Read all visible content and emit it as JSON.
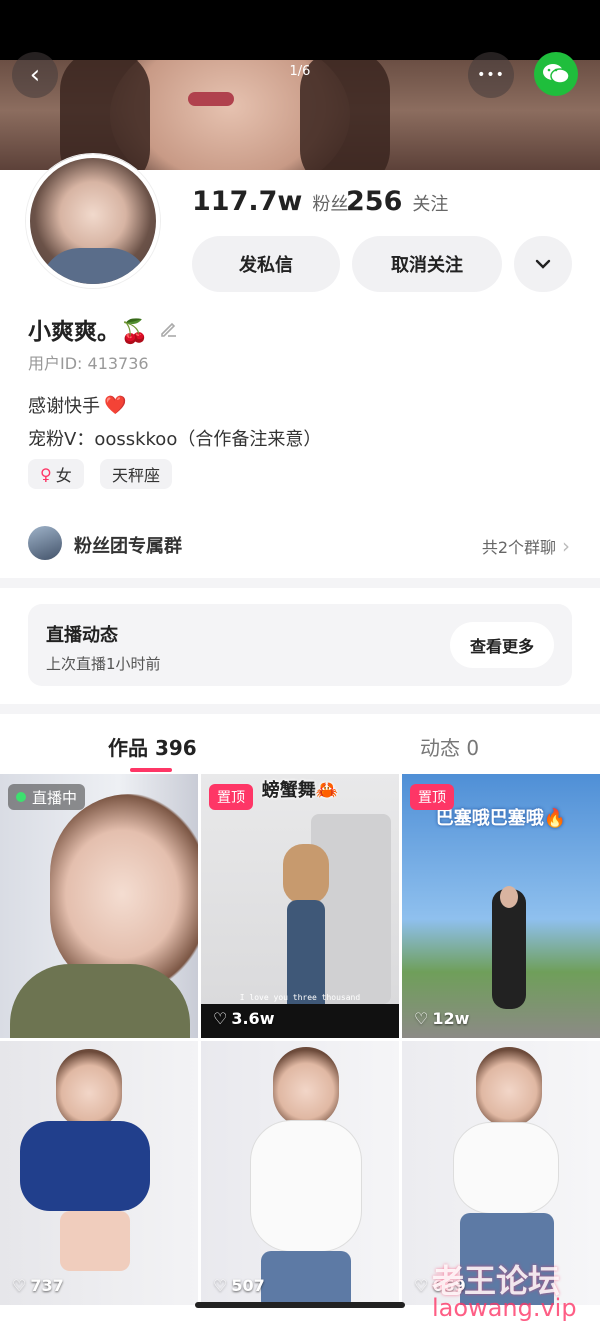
{
  "header": {
    "page_indicator": "1/6",
    "back_glyph": "‹",
    "more_glyph": "•••"
  },
  "profile": {
    "followers_count": "117.7w",
    "followers_label": "粉丝",
    "following_count": "256",
    "following_label": "关注",
    "message_button": "发私信",
    "unfollow_button": "取消关注",
    "dropdown_glyph": "⌄",
    "name": "小爽爽。🍒",
    "user_id": "用户ID: 413736",
    "bio_line1": "感谢快手",
    "bio_heart": "❤️",
    "bio_line2": "宠粉V：oosskkoo（合作备注来意）",
    "gender_symbol": "♀",
    "gender_tag": "女",
    "zodiac_tag": "天秤座"
  },
  "fan_group": {
    "title": "粉丝团专属群",
    "count_text": "共2个群聊",
    "chevron": "›"
  },
  "live_section": {
    "title": "直播动态",
    "subtitle": "上次直播1小时前",
    "button": "查看更多"
  },
  "tabs": [
    {
      "label": "作品 396"
    },
    {
      "label": "动态 0"
    }
  ],
  "videos": [
    {
      "badge": "直播中",
      "likes": ""
    },
    {
      "badge": "置顶",
      "caption": "螃蟹舞🦀",
      "subtitle_text": "I love you three thousand",
      "likes": "3.6w"
    },
    {
      "badge": "置顶",
      "caption": "巴塞哦巴塞哦🔥",
      "likes": "12w"
    },
    {
      "likes": "737"
    },
    {
      "likes": "507"
    },
    {
      "likes": "669"
    }
  ],
  "watermark": {
    "line1": "老王论坛",
    "line2": "laowang.vip"
  },
  "colors": {
    "accent": "#fe3666",
    "wechat": "#1fbe3c",
    "live_dot": "#3de06f"
  }
}
